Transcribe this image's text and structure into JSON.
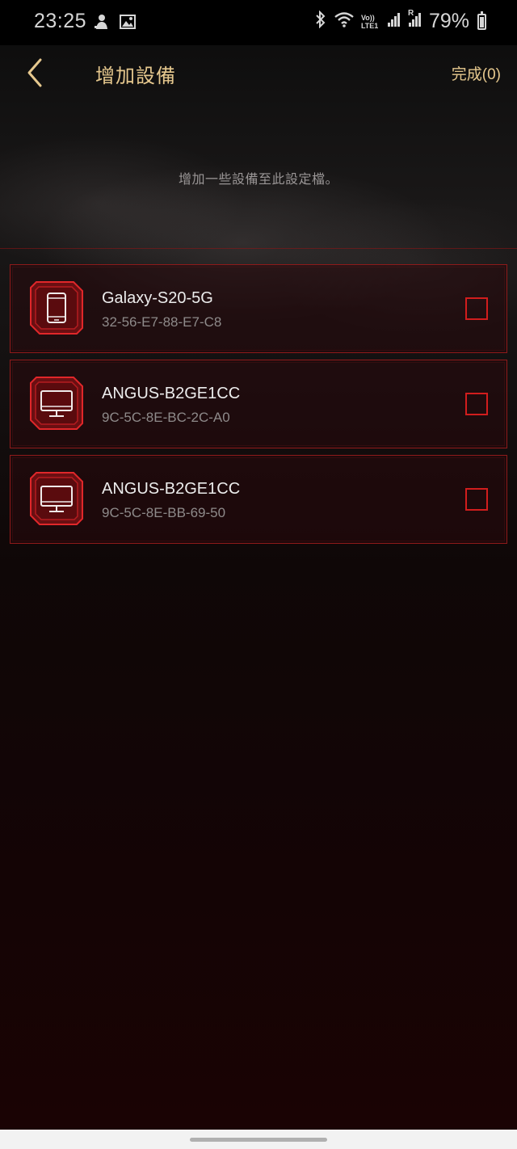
{
  "status_bar": {
    "time": "23:25",
    "battery_percent": "79%",
    "battery_level": 0.79,
    "icons": [
      "notification-icon",
      "gallery-icon",
      "bluetooth-icon",
      "wifi-icon",
      "volte-icon",
      "signal-icon",
      "signal-roaming-icon",
      "battery-icon"
    ],
    "network_label": "Vo)) LTE1",
    "roaming_label": "R"
  },
  "header": {
    "back_icon": "chevron-left-icon",
    "title": "增加設備",
    "done_label": "完成(0)"
  },
  "hint_text": "增加一些設備至此設定檔。",
  "devices": [
    {
      "name": "Galaxy-S20-5G",
      "mac": "32-56-E7-88-E7-C8",
      "icon": "phone-icon",
      "checked": false
    },
    {
      "name": "ANGUS-B2GE1CC",
      "mac": "9C-5C-8E-BC-2C-A0",
      "icon": "monitor-icon",
      "checked": false
    },
    {
      "name": "ANGUS-B2GE1CC",
      "mac": "9C-5C-8E-BB-69-50",
      "icon": "monitor-icon",
      "checked": false
    }
  ],
  "colors": {
    "accent_gold": "#e6c88e",
    "accent_red": "#d11d1d",
    "frame_red": "#8f1a1a"
  }
}
